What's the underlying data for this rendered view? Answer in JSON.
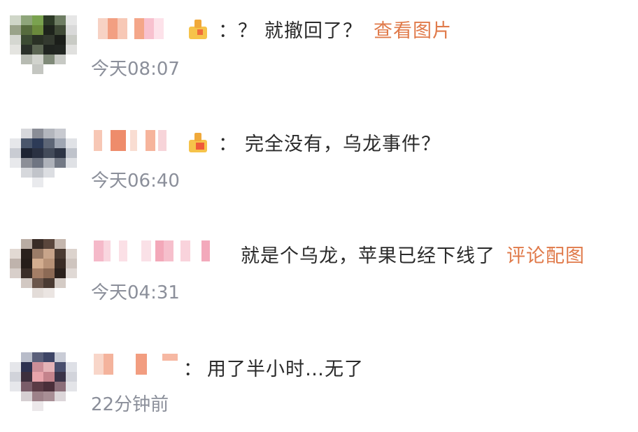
{
  "comments": [
    {
      "prefix": "：？",
      "text": "就撤回了？",
      "link": "查看图片",
      "time": "今天08:07"
    },
    {
      "prefix": "：",
      "text": "完全没有，乌龙事件？",
      "link": "",
      "time": "今天06:40"
    },
    {
      "prefix": "",
      "text": "就是个乌龙，苹果已经下线了",
      "link": "评论配图",
      "time": "今天04:31"
    },
    {
      "prefix": "：",
      "text": "用了半小时…无了",
      "link": "",
      "time": "22分钟前"
    }
  ],
  "colors": {
    "link": "#e07a4a",
    "time": "#8b8f9a",
    "text": "#2b2b2b"
  }
}
